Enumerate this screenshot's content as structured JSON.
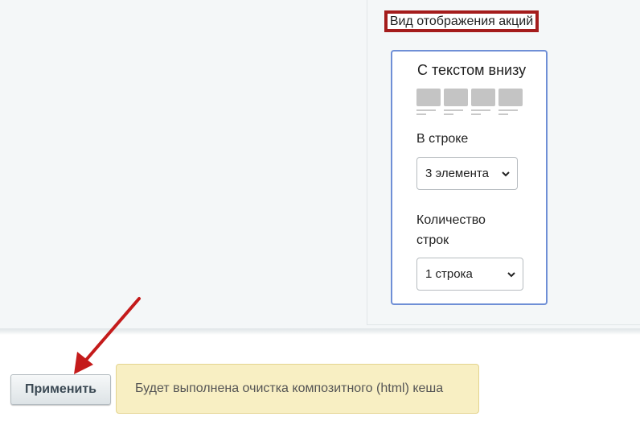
{
  "panel": {
    "section_title": "Вид отображения акций",
    "heading": "С текстом внизу",
    "layout_preview_icon": "four-tiles-with-text-below",
    "row_label": "В строке",
    "row_select_value": "3 элемента",
    "count_label": "Количество строк",
    "count_select_value": "1 строка"
  },
  "footer": {
    "apply_label": "Применить",
    "notice_text": "Будет выполнена очистка композитного (html) кеша"
  },
  "colors": {
    "highlight_border": "#a41c1c",
    "panel_border": "#6f8fd6",
    "notice_background": "#f8efc3",
    "arrow": "#c41b1b"
  }
}
